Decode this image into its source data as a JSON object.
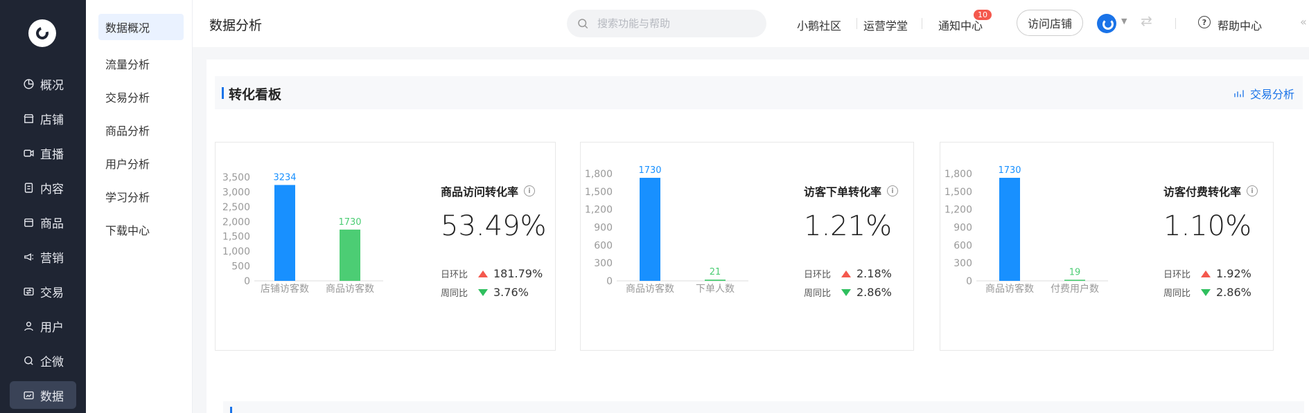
{
  "sidebar_main": {
    "items": [
      {
        "label": "概况",
        "icon": "pie-chart-icon"
      },
      {
        "label": "店铺",
        "icon": "shop-icon"
      },
      {
        "label": "直播",
        "icon": "live-camera-icon"
      },
      {
        "label": "内容",
        "icon": "document-icon"
      },
      {
        "label": "商品",
        "icon": "box-icon"
      },
      {
        "label": "营销",
        "icon": "megaphone-icon"
      },
      {
        "label": "交易",
        "icon": "trade-icon"
      },
      {
        "label": "用户",
        "icon": "user-icon"
      },
      {
        "label": "企微",
        "icon": "wecom-icon"
      },
      {
        "label": "数据",
        "icon": "data-icon",
        "active": true
      }
    ]
  },
  "sidebar_sub": {
    "items": [
      {
        "label": "数据概况",
        "active": true
      },
      {
        "label": "流量分析"
      },
      {
        "label": "交易分析"
      },
      {
        "label": "商品分析"
      },
      {
        "label": "用户分析"
      },
      {
        "label": "学习分析"
      },
      {
        "label": "下载中心"
      }
    ]
  },
  "header": {
    "title": "数据分析",
    "search_placeholder": "搜索功能与帮助",
    "links": [
      "小鹅社区",
      "运营学堂",
      "通知中心"
    ],
    "notification_count": "10",
    "visit_button": "访问店铺",
    "help": "帮助中心",
    "collapse": "«"
  },
  "board": {
    "title": "转化看板",
    "link": "交易分析"
  },
  "colors": {
    "blue": "#1890ff",
    "green": "#4ccd74",
    "up": "#f4584d",
    "down": "#2fbf5e"
  },
  "cards": [
    {
      "metric": "商品访问转化率",
      "value": "53.49%",
      "day_label": "日环比",
      "day_value": "181.79%",
      "day_dir": "up",
      "week_label": "周同比",
      "week_value": "3.76%",
      "week_dir": "down"
    },
    {
      "metric": "访客下单转化率",
      "value": "1.21%",
      "day_label": "日环比",
      "day_value": "2.18%",
      "day_dir": "up",
      "week_label": "周同比",
      "week_value": "2.86%",
      "week_dir": "down"
    },
    {
      "metric": "访客付费转化率",
      "value": "1.10%",
      "day_label": "日环比",
      "day_value": "1.92%",
      "day_dir": "up",
      "week_label": "周同比",
      "week_value": "2.86%",
      "week_dir": "down"
    }
  ],
  "chart_data": [
    {
      "type": "bar",
      "categories": [
        "店铺访客数",
        "商品访客数"
      ],
      "values": [
        3234,
        1730
      ],
      "ylim": [
        0,
        3500
      ],
      "yticks": [
        "0",
        "500",
        "1,000",
        "1,500",
        "2,000",
        "2,500",
        "3,000",
        "3,500"
      ],
      "grid": false
    },
    {
      "type": "bar",
      "categories": [
        "商品访客数",
        "下单人数"
      ],
      "values": [
        1730,
        21
      ],
      "ylim": [
        0,
        1800
      ],
      "yticks": [
        "0",
        "300",
        "600",
        "900",
        "1,200",
        "1,500",
        "1,800"
      ],
      "grid": false
    },
    {
      "type": "bar",
      "categories": [
        "商品访客数",
        "付费用户数"
      ],
      "values": [
        1730,
        19
      ],
      "ylim": [
        0,
        1800
      ],
      "yticks": [
        "0",
        "300",
        "600",
        "900",
        "1,200",
        "1,500",
        "1,800"
      ],
      "grid": false
    }
  ]
}
